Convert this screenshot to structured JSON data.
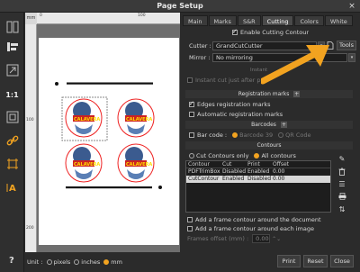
{
  "window": {
    "title": "Page Setup",
    "close_glyph": "×"
  },
  "left_toolbar": {
    "items": [
      {
        "name": "layout-icon"
      },
      {
        "name": "align-icon"
      },
      {
        "name": "fit-page-icon"
      },
      {
        "name": "actual-size-icon"
      },
      {
        "name": "frame-icon"
      },
      {
        "name": "link-icon"
      },
      {
        "name": "crop-marks-icon"
      },
      {
        "name": "text-cursor-icon"
      }
    ],
    "actual_size_label": "1:1"
  },
  "rulers": {
    "corner": "mm",
    "top_labels": [
      "0",
      "100"
    ],
    "left_labels": [
      "100",
      "200"
    ]
  },
  "tabs": [
    {
      "label": "Main",
      "active": false
    },
    {
      "label": "Marks",
      "active": false
    },
    {
      "label": "S&R",
      "active": false
    },
    {
      "label": "Cutting",
      "active": true
    },
    {
      "label": "Colors",
      "active": false
    },
    {
      "label": "White",
      "active": false
    }
  ],
  "cutting": {
    "enable_label": "Enable Cutting Contour",
    "enabled": true,
    "cutter_label": "Cutter :",
    "cutter_value": "GrandCutCutter",
    "tools_label": "Tools",
    "mirror_label": "Mirror :",
    "mirror_value": "No mirroring",
    "instant_label": "Instant cut just after pr",
    "instant_prefix": "Instant"
  },
  "registration": {
    "header": "Registration marks",
    "edges_label": "Edges registration marks",
    "edges_checked": true,
    "automatic_label": "Automatic registration marks",
    "automatic_checked": false
  },
  "barcodes": {
    "header": "Barcodes",
    "barcode_label": "Bar code :",
    "barcode39_label": "Barcode 39",
    "qr_label": "QR Code",
    "selected": "Barcode 39"
  },
  "contours": {
    "header": "Contours",
    "cut_only_label": "Cut Contours only",
    "all_label": "All contours",
    "selected": "All contours",
    "columns": [
      "Contour",
      "Cut",
      "Print",
      "Offset"
    ],
    "rows": [
      {
        "contour": "PDFTrimBox",
        "cut": "Disabled",
        "print": "Enabled",
        "offset": "0.00",
        "selected": false
      },
      {
        "contour": "CutContour",
        "cut": "Enabled",
        "print": "Disabled",
        "offset": "0.00",
        "selected": true
      }
    ],
    "frame_document_label": "Add a frame contour around the document",
    "frame_image_label": "Add a frame contour around each image",
    "frames_offset_label": "Frames offset (mm) :",
    "frames_offset_value": "0.00"
  },
  "bottom": {
    "help": "?",
    "unit_label": "Unit :",
    "units": [
      "pixels",
      "inches",
      "mm"
    ],
    "selected_unit": "mm",
    "print_label": "Print",
    "reset_label": "Reset",
    "close_label": "Close"
  },
  "colors": {
    "accent": "#f2a320",
    "arrow": "#f2a320"
  }
}
